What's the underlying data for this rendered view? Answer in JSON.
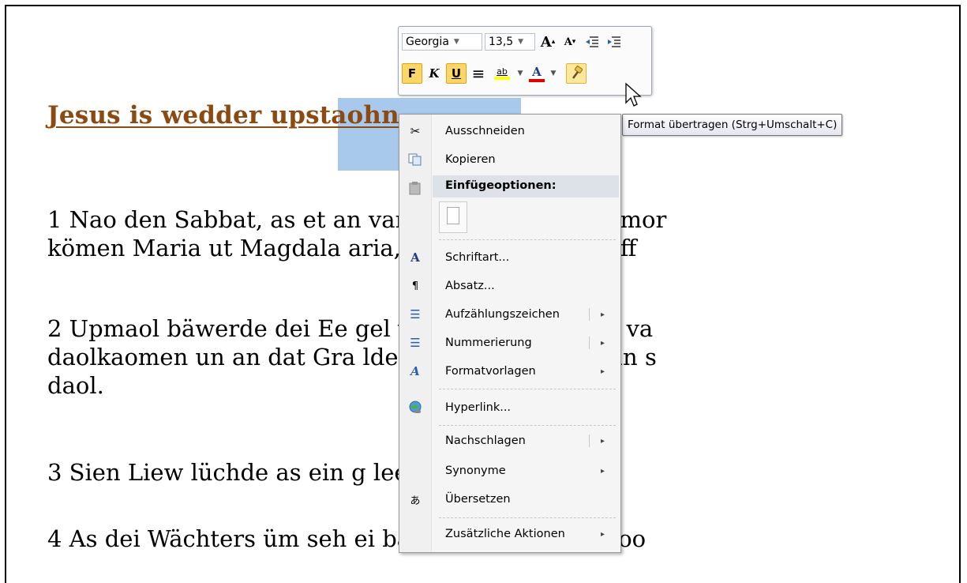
{
  "document": {
    "title_underlined": "Jesus is wedder ",
    "title_selected": "upstaohn",
    "paragraphs": [
      "1 Nao den Sabbat, as et an                           van dei neien Wäke s’mor",
      "kömen Maria ut Magdala                           aria, sei wullen dat Graff",
      "2 Upmaol bäwerde dei Ee                          gel van den Herrn was va",
      "daolkaomen un an dat Gra                          lde den Stein biesiet un s",
      "daol.",
      "3 Sien Liew lüchde as ein                           g leet witt as Schnei.",
      "4 As dei Wächters üm seh                           ei bange un füllen as doo"
    ]
  },
  "mini_toolbar": {
    "font_name": "Georgia",
    "font_size": "13,5",
    "grow_font_label": "A",
    "shrink_font_label": "A",
    "bold_label": "F",
    "italic_label": "K",
    "underline_label": "U",
    "center_label": "≡",
    "highlight_label": "ab",
    "font_color_label": "A",
    "highlight_color": "#ffff00",
    "font_color": "#e00000",
    "active_color": "#fcd667"
  },
  "context_menu": {
    "items": [
      {
        "label": "Ausschneiden",
        "icon": "scissors-icon"
      },
      {
        "label": "Kopieren",
        "icon": "copy-icon"
      },
      {
        "label": "Einfügeoptionen:",
        "icon": "paste-icon"
      },
      {
        "label": "Schriftart...",
        "icon": "font-icon"
      },
      {
        "label": "Absatz...",
        "icon": "paragraph-icon"
      },
      {
        "label": "Aufzählungszeichen",
        "icon": "bullets-icon"
      },
      {
        "label": "Nummerierung",
        "icon": "numbering-icon"
      },
      {
        "label": "Formatvorlagen",
        "icon": "styles-icon"
      },
      {
        "label": "Hyperlink...",
        "icon": "hyperlink-icon"
      },
      {
        "label": "Nachschlagen",
        "icon": ""
      },
      {
        "label": "Synonyme",
        "icon": ""
      },
      {
        "label": "Übersetzen",
        "icon": "translate-icon"
      },
      {
        "label": "Zusätzliche Aktionen",
        "icon": ""
      }
    ],
    "submenu_arrow": "▸"
  },
  "tooltip": {
    "text": "Format übertragen (Strg+Umschalt+C)"
  }
}
